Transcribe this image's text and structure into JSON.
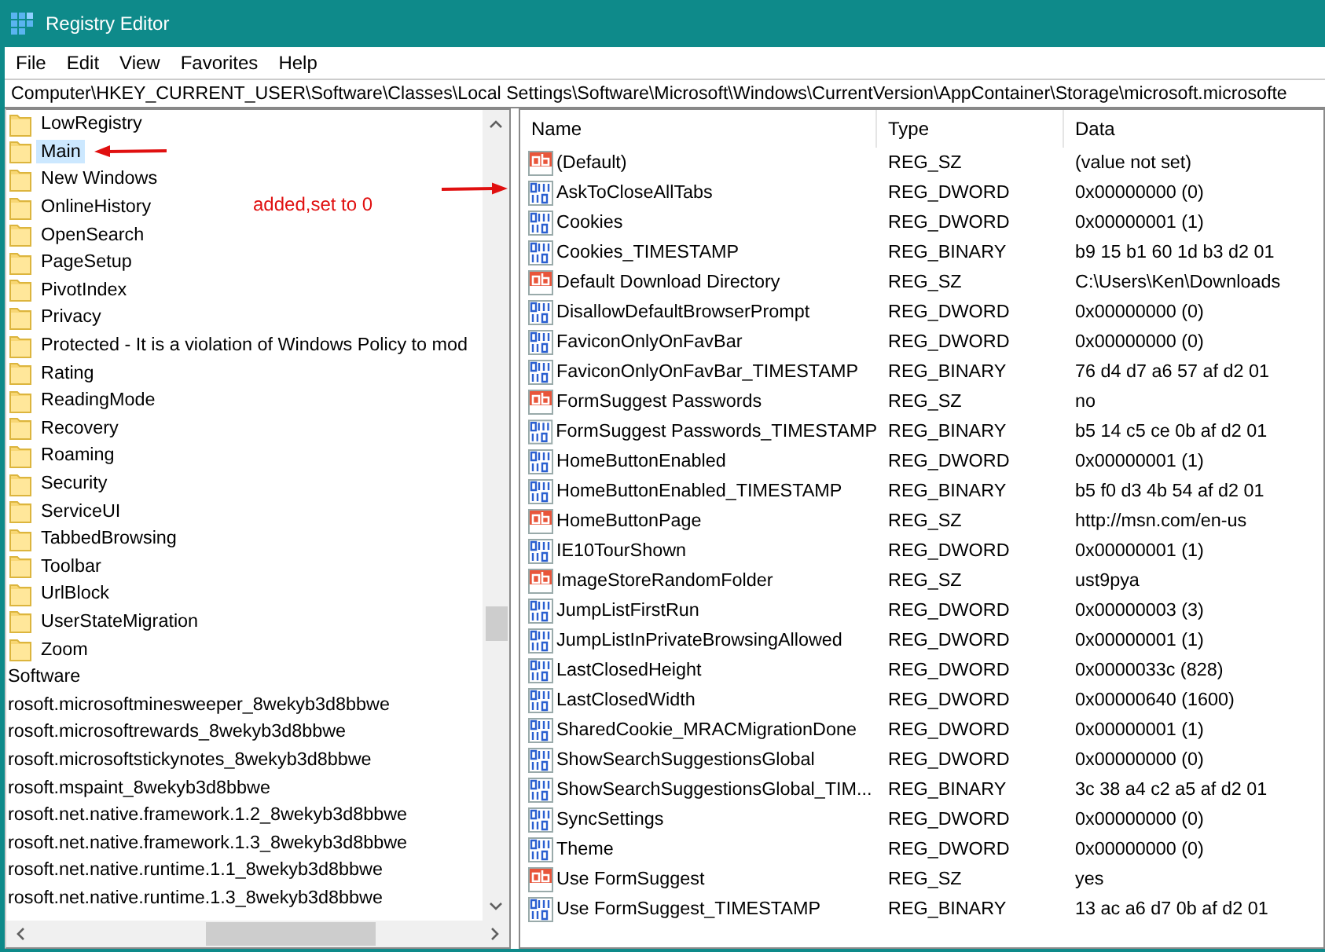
{
  "window": {
    "title": "Registry Editor"
  },
  "menu": [
    {
      "label": "File"
    },
    {
      "label": "Edit"
    },
    {
      "label": "View"
    },
    {
      "label": "Favorites"
    },
    {
      "label": "Help"
    }
  ],
  "address": "Computer\\HKEY_CURRENT_USER\\Software\\Classes\\Local Settings\\Software\\Microsoft\\Windows\\CurrentVersion\\AppContainer\\Storage\\microsoft.microsofte",
  "tree": [
    {
      "label": "LowRegistry",
      "kind": "folder",
      "selected": false
    },
    {
      "label": "Main",
      "kind": "folder",
      "selected": true
    },
    {
      "label": "New Windows",
      "kind": "folder",
      "selected": false
    },
    {
      "label": "OnlineHistory",
      "kind": "folder",
      "selected": false
    },
    {
      "label": "OpenSearch",
      "kind": "folder",
      "selected": false
    },
    {
      "label": "PageSetup",
      "kind": "folder",
      "selected": false
    },
    {
      "label": "PivotIndex",
      "kind": "folder",
      "selected": false
    },
    {
      "label": "Privacy",
      "kind": "folder",
      "selected": false
    },
    {
      "label": "Protected - It is a violation of Windows Policy to mod",
      "kind": "folder",
      "selected": false
    },
    {
      "label": "Rating",
      "kind": "folder",
      "selected": false
    },
    {
      "label": "ReadingMode",
      "kind": "folder",
      "selected": false
    },
    {
      "label": "Recovery",
      "kind": "folder",
      "selected": false
    },
    {
      "label": "Roaming",
      "kind": "folder",
      "selected": false
    },
    {
      "label": "Security",
      "kind": "folder",
      "selected": false
    },
    {
      "label": "ServiceUI",
      "kind": "folder",
      "selected": false
    },
    {
      "label": "TabbedBrowsing",
      "kind": "folder",
      "selected": false
    },
    {
      "label": "Toolbar",
      "kind": "folder",
      "selected": false
    },
    {
      "label": "UrlBlock",
      "kind": "folder",
      "selected": false
    },
    {
      "label": "UserStateMigration",
      "kind": "folder",
      "selected": false
    },
    {
      "label": "Zoom",
      "kind": "folder",
      "selected": false
    },
    {
      "label": "Software",
      "kind": "plain",
      "selected": false
    },
    {
      "label": "rosoft.microsoftminesweeper_8wekyb3d8bbwe",
      "kind": "plain",
      "selected": false
    },
    {
      "label": "rosoft.microsoftrewards_8wekyb3d8bbwe",
      "kind": "plain",
      "selected": false
    },
    {
      "label": "rosoft.microsoftstickynotes_8wekyb3d8bbwe",
      "kind": "plain",
      "selected": false
    },
    {
      "label": "rosoft.mspaint_8wekyb3d8bbwe",
      "kind": "plain",
      "selected": false
    },
    {
      "label": "rosoft.net.native.framework.1.2_8wekyb3d8bbwe",
      "kind": "plain",
      "selected": false
    },
    {
      "label": "rosoft.net.native.framework.1.3_8wekyb3d8bbwe",
      "kind": "plain",
      "selected": false
    },
    {
      "label": "rosoft.net.native.runtime.1.1_8wekyb3d8bbwe",
      "kind": "plain",
      "selected": false
    },
    {
      "label": "rosoft.net.native.runtime.1.3_8wekyb3d8bbwe",
      "kind": "plain",
      "selected": false
    }
  ],
  "annotation": {
    "text": "added,set to 0"
  },
  "table": {
    "columns": [
      "Name",
      "Type",
      "Data"
    ],
    "rows": [
      {
        "kind": "string",
        "name": "(Default)",
        "type": "REG_SZ",
        "data": "(value not set)"
      },
      {
        "kind": "binary",
        "name": "AskToCloseAllTabs",
        "type": "REG_DWORD",
        "data": "0x00000000 (0)"
      },
      {
        "kind": "binary",
        "name": "Cookies",
        "type": "REG_DWORD",
        "data": "0x00000001 (1)"
      },
      {
        "kind": "binary",
        "name": "Cookies_TIMESTAMP",
        "type": "REG_BINARY",
        "data": "b9 15 b1 60 1d b3 d2 01"
      },
      {
        "kind": "string",
        "name": "Default Download Directory",
        "type": "REG_SZ",
        "data": "C:\\Users\\Ken\\Downloads"
      },
      {
        "kind": "binary",
        "name": "DisallowDefaultBrowserPrompt",
        "type": "REG_DWORD",
        "data": "0x00000000 (0)"
      },
      {
        "kind": "binary",
        "name": "FaviconOnlyOnFavBar",
        "type": "REG_DWORD",
        "data": "0x00000000 (0)"
      },
      {
        "kind": "binary",
        "name": "FaviconOnlyOnFavBar_TIMESTAMP",
        "type": "REG_BINARY",
        "data": "76 d4 d7 a6 57 af d2 01"
      },
      {
        "kind": "string",
        "name": "FormSuggest Passwords",
        "type": "REG_SZ",
        "data": "no"
      },
      {
        "kind": "binary",
        "name": "FormSuggest Passwords_TIMESTAMP",
        "type": "REG_BINARY",
        "data": "b5 14 c5 ce 0b af d2 01"
      },
      {
        "kind": "binary",
        "name": "HomeButtonEnabled",
        "type": "REG_DWORD",
        "data": "0x00000001 (1)"
      },
      {
        "kind": "binary",
        "name": "HomeButtonEnabled_TIMESTAMP",
        "type": "REG_BINARY",
        "data": "b5 f0 d3 4b 54 af d2 01"
      },
      {
        "kind": "string",
        "name": "HomeButtonPage",
        "type": "REG_SZ",
        "data": "http://msn.com/en-us"
      },
      {
        "kind": "binary",
        "name": "IE10TourShown",
        "type": "REG_DWORD",
        "data": "0x00000001 (1)"
      },
      {
        "kind": "string",
        "name": "ImageStoreRandomFolder",
        "type": "REG_SZ",
        "data": "ust9pya"
      },
      {
        "kind": "binary",
        "name": "JumpListFirstRun",
        "type": "REG_DWORD",
        "data": "0x00000003 (3)"
      },
      {
        "kind": "binary",
        "name": "JumpListInPrivateBrowsingAllowed",
        "type": "REG_DWORD",
        "data": "0x00000001 (1)"
      },
      {
        "kind": "binary",
        "name": "LastClosedHeight",
        "type": "REG_DWORD",
        "data": "0x0000033c (828)"
      },
      {
        "kind": "binary",
        "name": "LastClosedWidth",
        "type": "REG_DWORD",
        "data": "0x00000640 (1600)"
      },
      {
        "kind": "binary",
        "name": "SharedCookie_MRACMigrationDone",
        "type": "REG_DWORD",
        "data": "0x00000001 (1)"
      },
      {
        "kind": "binary",
        "name": "ShowSearchSuggestionsGlobal",
        "type": "REG_DWORD",
        "data": "0x00000000 (0)"
      },
      {
        "kind": "binary",
        "name": "ShowSearchSuggestionsGlobal_TIM...",
        "type": "REG_BINARY",
        "data": "3c 38 a4 c2 a5 af d2 01"
      },
      {
        "kind": "binary",
        "name": "SyncSettings",
        "type": "REG_DWORD",
        "data": "0x00000000 (0)"
      },
      {
        "kind": "binary",
        "name": "Theme",
        "type": "REG_DWORD",
        "data": "0x00000000 (0)"
      },
      {
        "kind": "string",
        "name": "Use FormSuggest",
        "type": "REG_SZ",
        "data": "yes"
      },
      {
        "kind": "binary",
        "name": "Use FormSuggest_TIMESTAMP",
        "type": "REG_BINARY",
        "data": "13 ac a6 d7 0b af d2 01"
      }
    ]
  }
}
